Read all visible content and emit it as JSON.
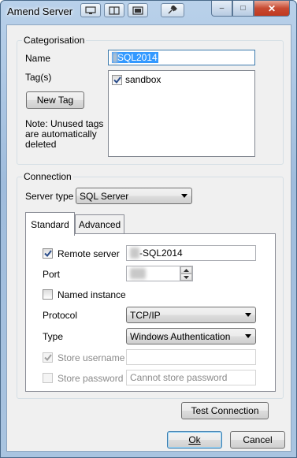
{
  "window": {
    "title": "Amend Server",
    "toolbar_icons": [
      "monitor-icon",
      "columns-icon",
      "panel-icon",
      "pin-icon"
    ],
    "caption_buttons": {
      "minimize": "–",
      "maximize": "□",
      "close": "✕"
    }
  },
  "categorisation": {
    "group_title": "Categorisation",
    "name_label": "Name",
    "name_value_visible": "SQL2014",
    "tags_label": "Tag(s)",
    "new_tag_button": "New Tag",
    "note": "Note: Unused tags are automatically deleted",
    "tags": [
      {
        "label": "sandbox",
        "checked": true
      }
    ]
  },
  "connection": {
    "group_title": "Connection",
    "server_type_label": "Server type",
    "server_type_value": "SQL Server",
    "tabs": [
      {
        "label": "Standard",
        "active": true
      },
      {
        "label": "Advanced",
        "active": false
      }
    ],
    "standard": {
      "remote_server_label": "Remote server",
      "remote_server_checked": true,
      "remote_server_value_visible": "-SQL2014",
      "port_label": "Port",
      "named_instance_label": "Named instance",
      "named_instance_checked": false,
      "protocol_label": "Protocol",
      "protocol_value": "TCP/IP",
      "type_label": "Type",
      "type_value": "Windows Authentication",
      "store_username_label": "Store username",
      "store_username_checked": true,
      "store_password_label": "Store password",
      "store_password_checked": false,
      "store_password_placeholder": "Cannot store password"
    },
    "test_connection_button": "Test Connection"
  },
  "footer": {
    "ok_button": "Ok",
    "cancel_button": "Cancel"
  },
  "colors": {
    "selection": "#3399ff",
    "checkmark": "#2a4c8a",
    "close_button": "#c7492f"
  }
}
